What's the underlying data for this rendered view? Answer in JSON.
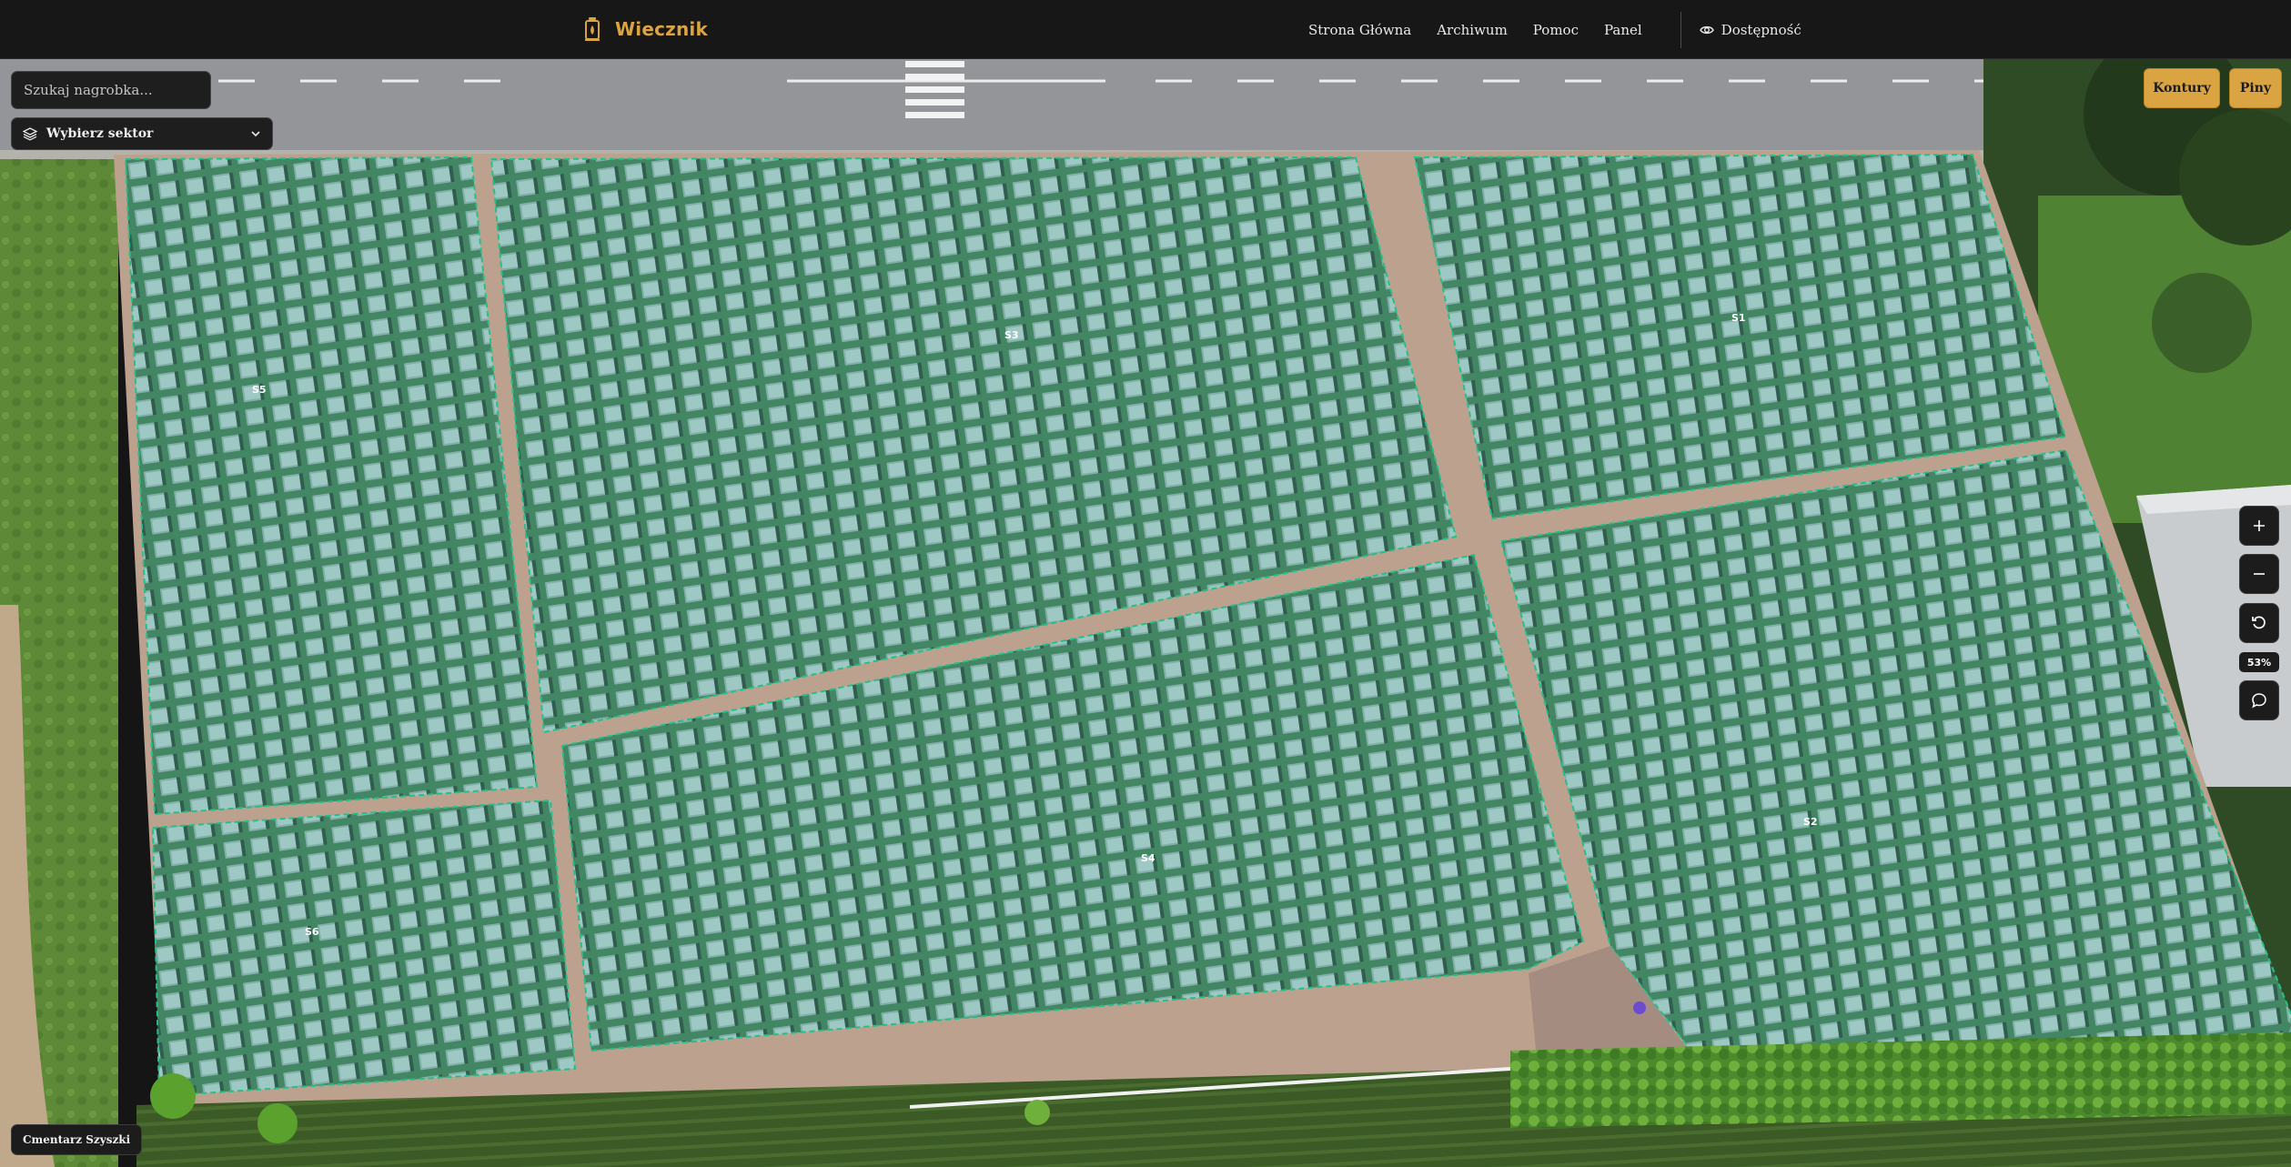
{
  "app": {
    "name": "Wiecznik"
  },
  "nav": {
    "links": [
      "Strona Główna",
      "Archiwum",
      "Pomoc",
      "Panel"
    ],
    "accessibility": "Dostępność"
  },
  "search": {
    "placeholder": "Szukaj nagrobka..."
  },
  "sector_select": {
    "label": "Wybierz sektor"
  },
  "modes": {
    "contours": "Kontury",
    "pins": "Piny"
  },
  "zoom": {
    "in_icon": "plus-icon",
    "out_icon": "minus-icon",
    "reset_icon": "reset-icon",
    "chat_icon": "chat-icon",
    "level": "53%"
  },
  "sectors": [
    {
      "id": "S1",
      "label": "S1"
    },
    {
      "id": "S2",
      "label": "S2"
    },
    {
      "id": "S3",
      "label": "S3"
    },
    {
      "id": "S4",
      "label": "S4"
    },
    {
      "id": "S5",
      "label": "S5"
    },
    {
      "id": "S6",
      "label": "S6"
    }
  ],
  "cemetery": {
    "name": "Cmentarz Szyszki"
  },
  "colors": {
    "accent": "#d9a441",
    "navbar": "#171717",
    "sector_outline": "#24c08a",
    "sector_fill": "#2fa4a0"
  }
}
